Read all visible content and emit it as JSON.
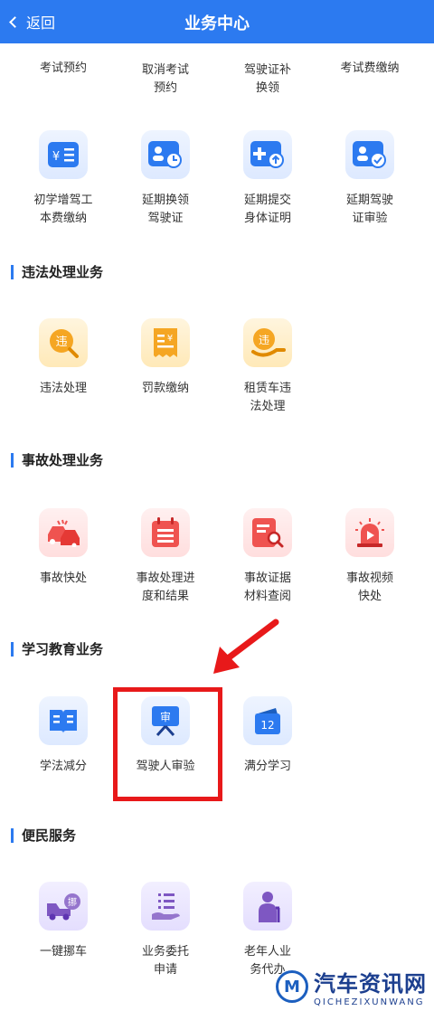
{
  "header": {
    "back_label": "返回",
    "title": "业务中心"
  },
  "top_row": [
    "考试预约",
    "取消考试\n预约",
    "驾驶证补\n换领",
    "考试费缴纳"
  ],
  "row2": [
    {
      "label": "初学增驾工\n本费缴纳",
      "icon": "fee-card-icon"
    },
    {
      "label": "延期换领\n驾驶证",
      "icon": "license-clock-icon"
    },
    {
      "label": "延期提交\n身体证明",
      "icon": "medical-upload-icon"
    },
    {
      "label": "延期驾驶\n证审验",
      "icon": "license-check-icon"
    }
  ],
  "sections": {
    "violation": {
      "title": "违法处理业务",
      "items": [
        {
          "label": "违法处理",
          "icon": "violation-search-icon"
        },
        {
          "label": "罚款缴纳",
          "icon": "fine-receipt-icon"
        },
        {
          "label": "租赁车违\n法处理",
          "icon": "rental-violation-icon"
        }
      ]
    },
    "accident": {
      "title": "事故处理业务",
      "items": [
        {
          "label": "事故快处",
          "icon": "car-collision-icon"
        },
        {
          "label": "事故处理进\n度和结果",
          "icon": "calendar-list-icon"
        },
        {
          "label": "事故证据\n材料查阅",
          "icon": "document-search-icon"
        },
        {
          "label": "事故视频\n快处",
          "icon": "alarm-video-icon"
        }
      ]
    },
    "education": {
      "title": "学习教育业务",
      "items": [
        {
          "label": "学法减分",
          "icon": "book-icon"
        },
        {
          "label": "驾驶人审验",
          "icon": "review-board-icon"
        },
        {
          "label": "满分学习",
          "icon": "calendar-12-icon",
          "badge": "12"
        }
      ]
    },
    "service": {
      "title": "便民服务",
      "items": [
        {
          "label": "一键挪车",
          "icon": "tow-truck-icon",
          "badge": "挪"
        },
        {
          "label": "业务委托\n申请",
          "icon": "delegate-hand-icon"
        },
        {
          "label": "老年人业\n务代办",
          "icon": "elderly-icon"
        }
      ]
    }
  },
  "badges": {
    "violation": "违",
    "fine": "¥",
    "review": "审"
  },
  "watermark": {
    "logo": "M",
    "cn": "汽车资讯网",
    "en": "QICHEZIXUNWANG"
  },
  "colors": {
    "header": "#2c7af0",
    "highlight": "#e8191a"
  }
}
